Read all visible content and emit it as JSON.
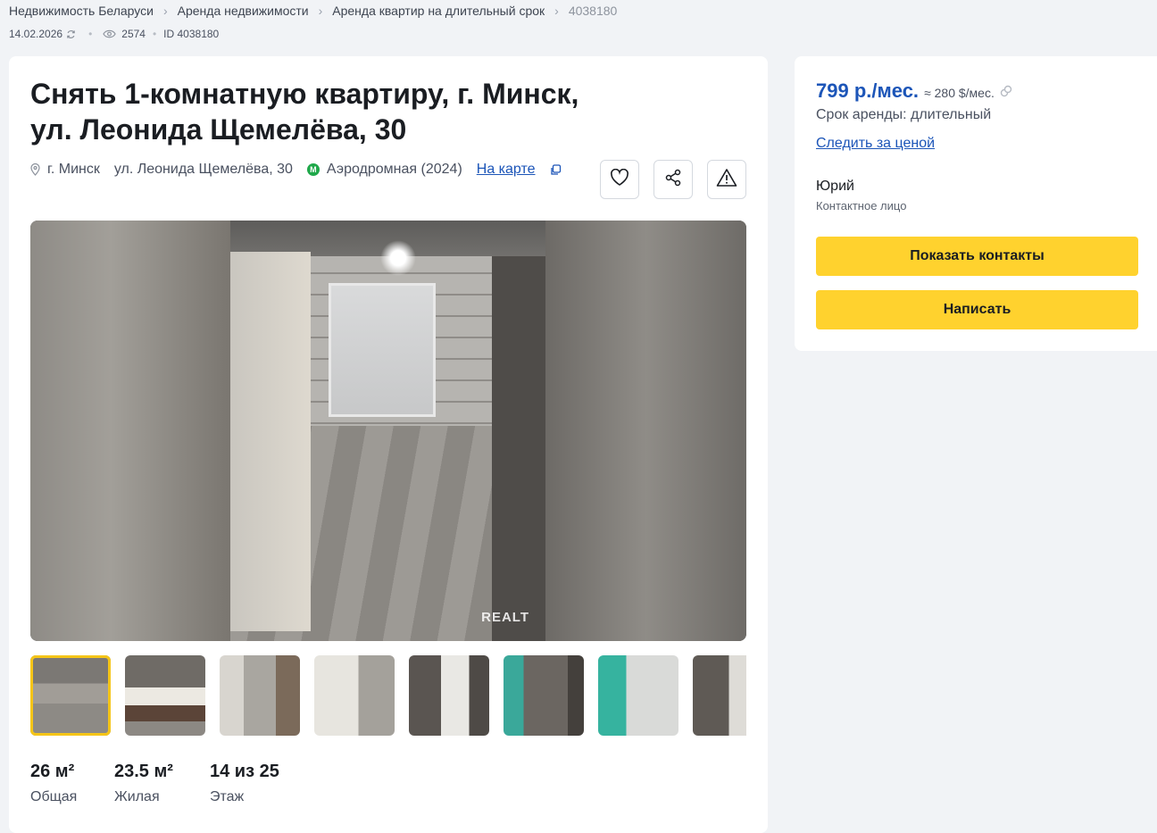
{
  "breadcrumbs": {
    "items": [
      "Недвижимость Беларуси",
      "Аренда недвижимости",
      "Аренда квартир на длительный срок"
    ],
    "current": "4038180"
  },
  "meta": {
    "date": "14.02.2026",
    "views": "2574",
    "id": "ID 4038180"
  },
  "listing": {
    "title_line1": "Снять 1-комнатную квартиру, г. Минск,",
    "title_line2": "ул. Леонида Щемелёва, 30",
    "city": "г. Минск",
    "street": "ул. Леонида Щемелёва, 30",
    "metro": "Аэродромная (2024)",
    "metro_badge": "M",
    "map_link": "На карте",
    "watermark": "REALT"
  },
  "stats": [
    {
      "value": "26 м²",
      "label": "Общая"
    },
    {
      "value": "23.5 м²",
      "label": "Жилая"
    },
    {
      "value": "14 из 25",
      "label": "Этаж"
    }
  ],
  "sidebar": {
    "price_byn": "799 р./мес.",
    "price_usd": "≈ 280 $/мес.",
    "term": "Срок аренды: длительный",
    "follow_price": "Следить за ценой",
    "contact_name": "Юрий",
    "contact_role": "Контактное лицо",
    "show_contacts": "Показать контакты",
    "write": "Написать"
  },
  "colors": {
    "accent": "#1c55b8",
    "button": "#ffd22e",
    "metro": "#1fa84a",
    "thumb_active": "#f5c518"
  },
  "icons": [
    "refresh-icon",
    "eye-icon",
    "pin-icon",
    "copy-icon",
    "heart-icon",
    "share-icon",
    "warning-icon",
    "currency-convert-icon"
  ]
}
